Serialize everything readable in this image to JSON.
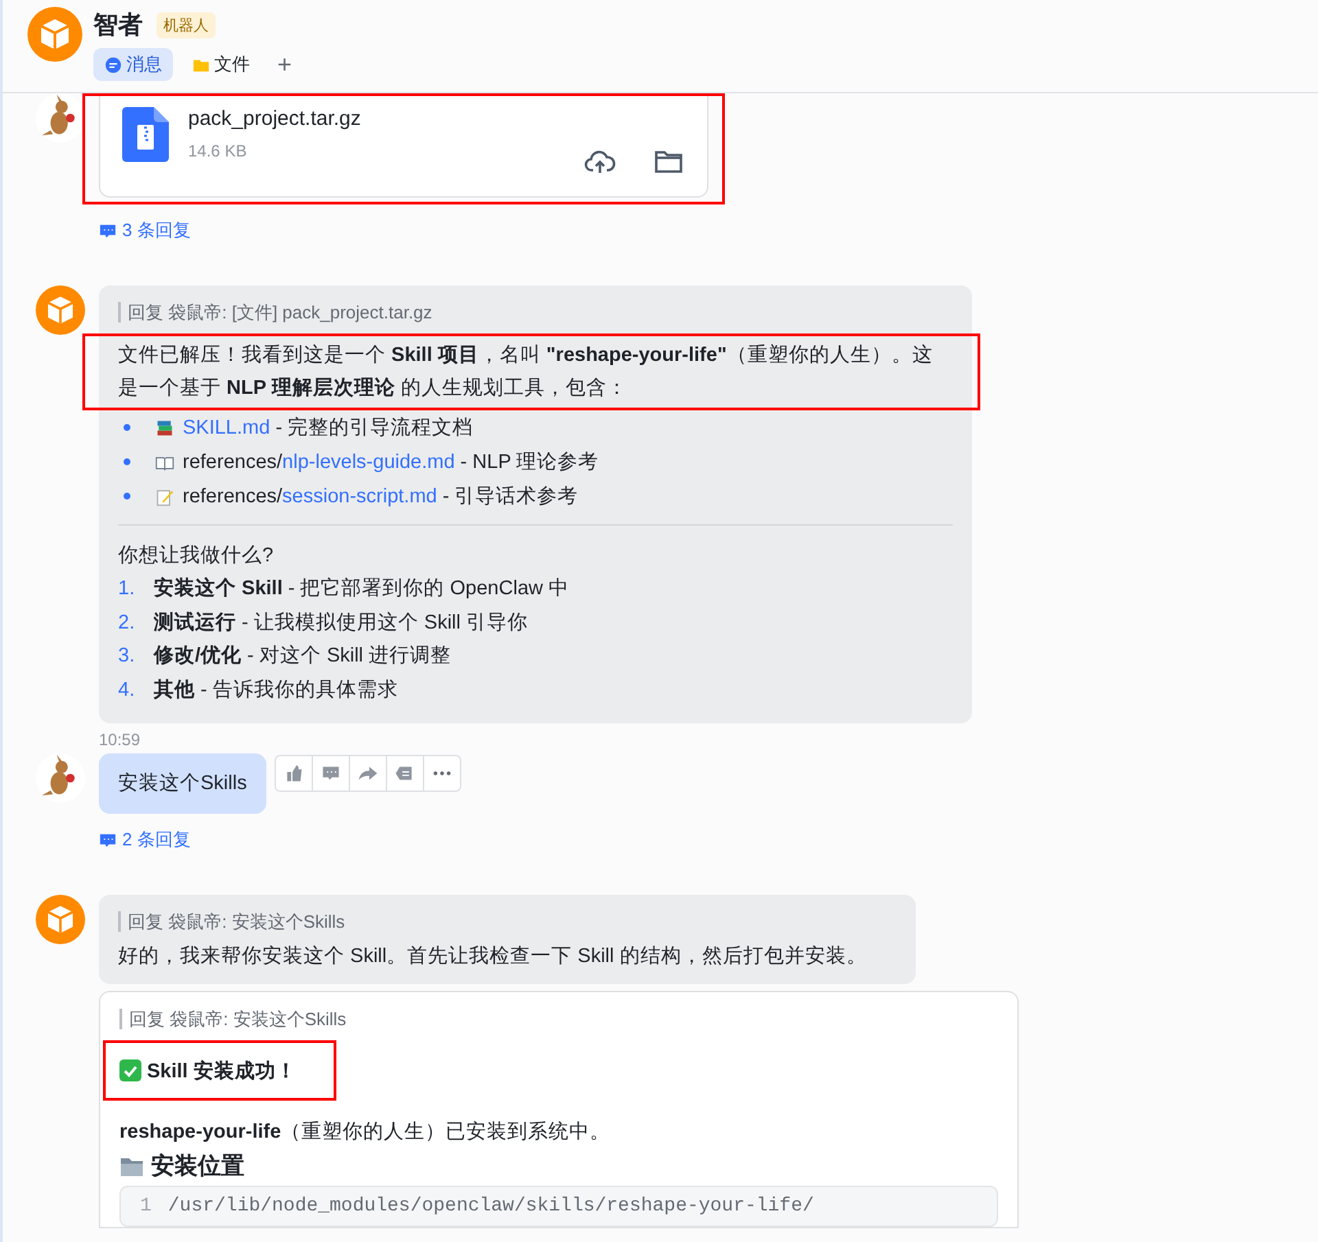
{
  "header": {
    "title": "智者",
    "badge": "机器人",
    "tabs": [
      {
        "label": "消息",
        "selected": true
      },
      {
        "label": "文件",
        "selected": false
      }
    ],
    "add": "+"
  },
  "messages": [
    {
      "kind": "user",
      "parts": [
        {
          "kind": "file",
          "highlighted": true,
          "name": "pack_project.tar.gz",
          "size": "14.6 KB"
        }
      ],
      "replies": "3 条回复"
    },
    {
      "kind": "bot",
      "parts": [
        {
          "kind": "rich",
          "quote": "回复 袋鼠帝: [文件] pack_project.tar.gz",
          "paragraph": "文件已解压！我看到这是一个 **Skill 项目**，名叫 **\"reshape-your-life\"**（重塑你的人生）。这是一个基于 **NLP 理解层次理论** 的人生规划工具，包含：",
          "highlighted": true,
          "bullets": [
            {
              "link": "SKILL.md",
              "suffix": " - 完整的引导流程文档"
            },
            {
              "prefix": "references/",
              "link": "nlp-levels-guide.md",
              "suffix": " - NLP 理论参考"
            },
            {
              "prefix": "references/",
              "link": "session-script.md",
              "suffix": " - 引导话术参考"
            }
          ],
          "question": "你想让我做什么?",
          "options": [
            {
              "number": "1.",
              "title": "安装这个 Skill",
              "desc": " - 把它部署到你的 OpenClaw 中"
            },
            {
              "number": "2.",
              "title": "测试运行",
              "desc": " - 让我模拟使用这个 Skill 引导你"
            },
            {
              "number": "3.",
              "title": "修改/优化",
              "desc": " - 对这个 Skill 进行调整"
            },
            {
              "number": "4.",
              "title": "其他",
              "desc": " - 告诉我你的具体需求"
            }
          ]
        }
      ]
    },
    {
      "kind": "user",
      "time": "10:59",
      "parts": [
        {
          "kind": "text",
          "text": "安装这个Skills",
          "toolbar": true
        }
      ],
      "replies": "2 条回复"
    },
    {
      "kind": "bot",
      "parts": [
        {
          "kind": "text",
          "quote": "回复 袋鼠帝: 安装这个Skills",
          "text": "好的，我来帮你安装这个 Skill。首先让我检查一下 Skill 的结构，然后打包并安装。"
        },
        {
          "kind": "card",
          "quote": "回复 袋鼠帝: 安装这个Skills",
          "heading": "Skill 安装成功！",
          "highlighted": true,
          "paragraph": "**reshape-your-life**（重塑你的人生）已安装到系统中。",
          "section": "安装位置",
          "code": [
            {
              "number": "1",
              "text": "/usr/lib/node_modules/openclaw/skills/reshape-your-life/"
            }
          ]
        }
      ]
    }
  ]
}
